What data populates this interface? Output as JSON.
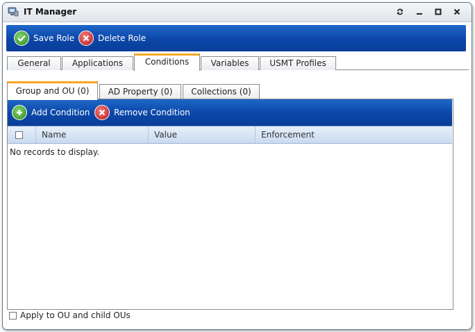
{
  "window": {
    "title": "IT Manager",
    "icons": {
      "app": "computer-icon",
      "refresh": "refresh-icon",
      "minimize": "minimize-icon",
      "maximize": "maximize-icon",
      "close": "close-icon"
    }
  },
  "toolbar": {
    "save_label": "Save Role",
    "delete_label": "Delete Role",
    "save_icon": "check-circle-icon",
    "delete_icon": "x-circle-icon"
  },
  "tabs": [
    {
      "label": "General",
      "active": false
    },
    {
      "label": "Applications",
      "active": false
    },
    {
      "label": "Conditions",
      "active": true
    },
    {
      "label": "Variables",
      "active": false
    },
    {
      "label": "USMT Profiles",
      "active": false
    }
  ],
  "subtabs": [
    {
      "label": "Group and OU (0)",
      "active": true
    },
    {
      "label": "AD Property (0)",
      "active": false
    },
    {
      "label": "Collections (0)",
      "active": false
    }
  ],
  "conditions_toolbar": {
    "add_label": "Add Condition",
    "remove_label": "Remove Condition",
    "add_icon": "plus-circle-icon",
    "remove_icon": "x-circle-icon"
  },
  "grid": {
    "columns": [
      "Name",
      "Value",
      "Enforcement"
    ],
    "select_all_checked": false,
    "empty_text": "No records to display."
  },
  "footer": {
    "checkbox_label": "Apply to OU and child OUs",
    "checked": false
  },
  "colors": {
    "toolbar_blue": "#0b46a8",
    "active_tab_accent": "#f5a623",
    "save_green": "#3a9a2e",
    "delete_red": "#c62828"
  }
}
